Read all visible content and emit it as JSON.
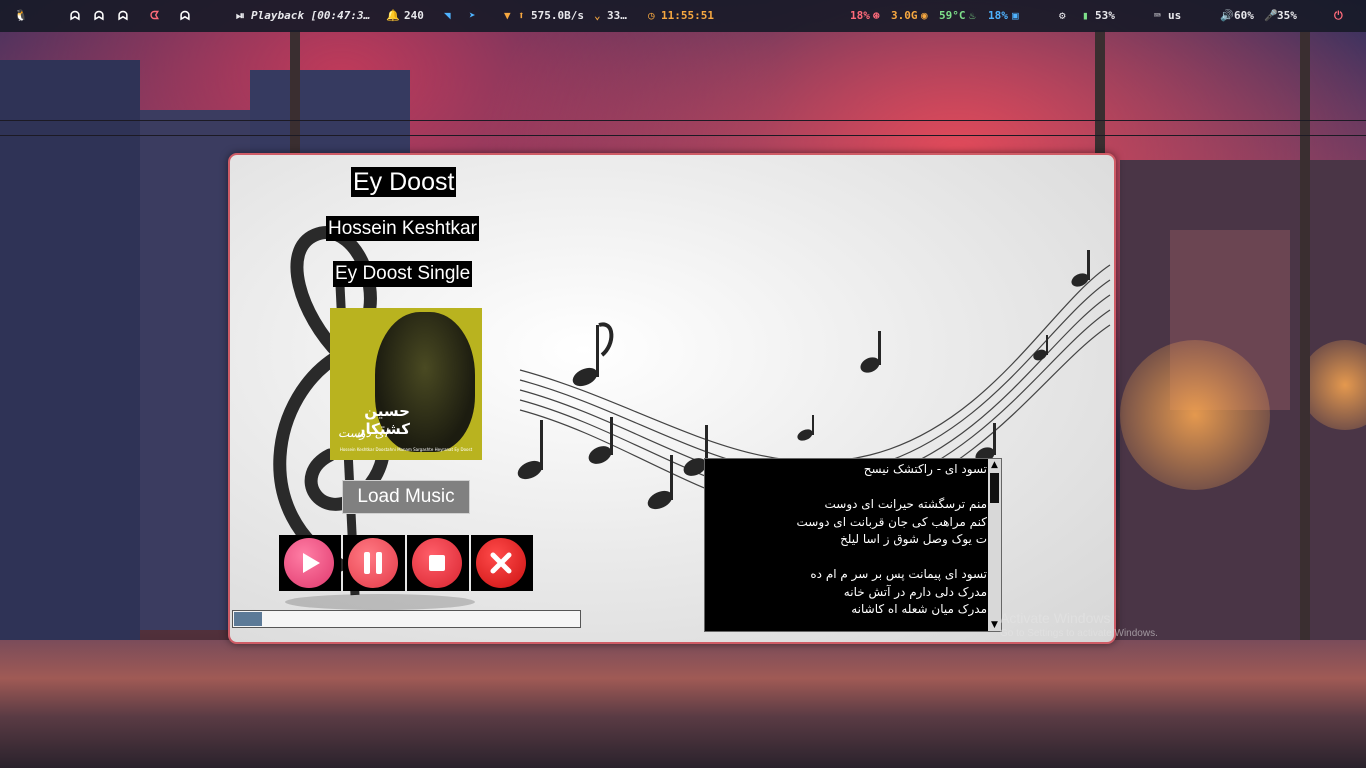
{
  "topbar": {
    "os_icon": "linux-tux-icon",
    "workspaces": [
      "ghost-icon",
      "ghost-icon",
      "ghost-icon",
      "pacman-icon",
      "ghost-icon"
    ],
    "media_icon": "play-pause-icon",
    "media_text": "Playback [00:47:3…",
    "notifications_icon": "bell-icon",
    "notifications_count": "240",
    "wifi_icon": "wifi-icon",
    "telegram_icon": "telegram-icon",
    "net_down_icon": "arrow-down-icon",
    "net_up_icon": "arrow-up-icon",
    "net_speed": "575.0B/s",
    "net_extra_icon": "chevron-down-icon",
    "net_extra": "33…",
    "clock_icon": "clock-icon",
    "time": "11:55:51",
    "cpu": "18%",
    "cpu_icon": "cpu-icon",
    "ram": "3.0G",
    "ram_icon": "memory-icon",
    "temp": "59°C",
    "temp_icon": "flame-icon",
    "disk": "18%",
    "disk_icon": "disk-icon",
    "settings_icon": "gear-icon",
    "battery": "53%",
    "battery_icon": "battery-icon",
    "keyboard_icon": "keyboard-icon",
    "keyboard_layout": "us",
    "volume_icon": "speaker-icon",
    "volume": "60%",
    "mic_icon": "microphone-icon",
    "mic": "35%",
    "power_icon": "power-icon",
    "colors": {
      "blue": "#4fb3ff",
      "orange": "#f7a840",
      "red": "#ff6b7a",
      "purple": "#b58cff",
      "green": "#7ee08a"
    }
  },
  "player": {
    "song_title": "Ey Doost",
    "artist": "Hossein Keshtkar",
    "album": "Ey Doost Single",
    "cover": {
      "title_fa": "حسین کشتکار",
      "subtitle_fa": "ای دوست",
      "caption": "Hossein Keshtkar Doostahni Manam Sargashte Heyranat Ey Doost"
    },
    "load_button": "Load Music",
    "controls": {
      "play": "play-icon",
      "pause": "pause-icon",
      "stop": "stop-icon",
      "close": "close-icon"
    },
    "progress": 0.08,
    "lyrics": "تسود ای - راکتشک نیسح\n\nمنم ترسگشته حیرانت ای دوست\nکنم مراهب کی جان قربانت ای دوست\nت یوک وصل شوق ز اسا لیلخ \n\nتسود ای پیمانت پس بر سر م ام ده\nمدرک دلی دارم در آتش خانه\nمدرک میان شعله اه کاشانه",
    "scrollbar_up": "▲",
    "scrollbar_down": "▼"
  },
  "watermark": {
    "line1": "Activate Windows",
    "line2": "Go to Settings to activate Windows."
  }
}
